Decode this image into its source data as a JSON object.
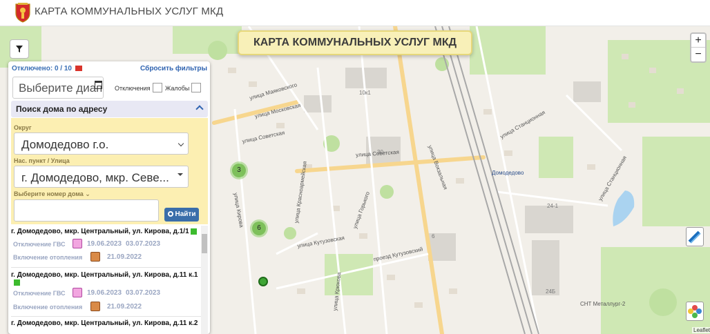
{
  "header": {
    "title": "КАРТА КОММУНАЛЬНЫХ УСЛУГ МКД"
  },
  "map": {
    "banner": "КАРТА КОММУНАЛЬНЫХ УСЛУГ МКД",
    "zoom_in": "+",
    "zoom_out": "−",
    "attribution": "Leaflet",
    "clusters": [
      "3",
      "6"
    ],
    "labels": {
      "ul_sovetskaya": "улица Советская",
      "ul_sovetskaya2": "улица Советская",
      "ul_kirova": "улица Кирова",
      "ul_gorkogo": "улица Горького",
      "ul_kutuzovskaya": "улица Кутузовская",
      "ul_kutuzovsky": "проезд Кутузовский",
      "ul_stancionnaya": "улица Станционная",
      "ul_stancionnaya2": "улица Станционная",
      "ul_moskovskaya": "улица Московская",
      "ul_krasnoarm": "улица Красноармейская",
      "ul_mayakovskogo": "улица Маяковского",
      "ul_vokzalnaya": "улица Вокзальная",
      "ul_kryukova": "улица Крюкова",
      "domodedovo_st": "Домодедово",
      "snt": "СНТ Металлург-2",
      "b30": "30",
      "b10k1": "10к1",
      "b24_1": "24-1",
      "b24b": "24Б",
      "b6": "6"
    }
  },
  "panel": {
    "outages_label": "Отключено: 0 / 10",
    "reset_filters": "Сбросить фильтры",
    "date_placeholder": "Выберите диап",
    "outages_check": "Отключения",
    "complaints_check": "Жалобы",
    "search_title": "Поиск дома по адресу",
    "district_label": "Округ",
    "district_value": "Домодедово г.о.",
    "street_label": "Нас. пункт / Улица",
    "street_value": "г. Домодедово, мкр. Севе...",
    "house_label": "Выберите номер дома ⌄",
    "find_button": "Найти",
    "results": [
      {
        "address": "г. Домодедово, мкр. Центральный, ул. Кирова, д.1/1",
        "gvs_label": "Отключение ГВС",
        "gvs_from": "19.06.2023",
        "gvs_to": "03.07.2023",
        "heat_label": "Включение отопления",
        "heat_date": "21.09.2022"
      },
      {
        "address": "г. Домодедово, мкр. Центральный, ул. Кирова, д.11 к.1",
        "gvs_label": "Отключение ГВС",
        "gvs_from": "19.06.2023",
        "gvs_to": "03.07.2023",
        "heat_label": "Включение отопления",
        "heat_date": "21.09.2022"
      },
      {
        "address": "г. Домодедово, мкр. Центральный, ул. Кирова, д.11 к.2"
      }
    ]
  }
}
